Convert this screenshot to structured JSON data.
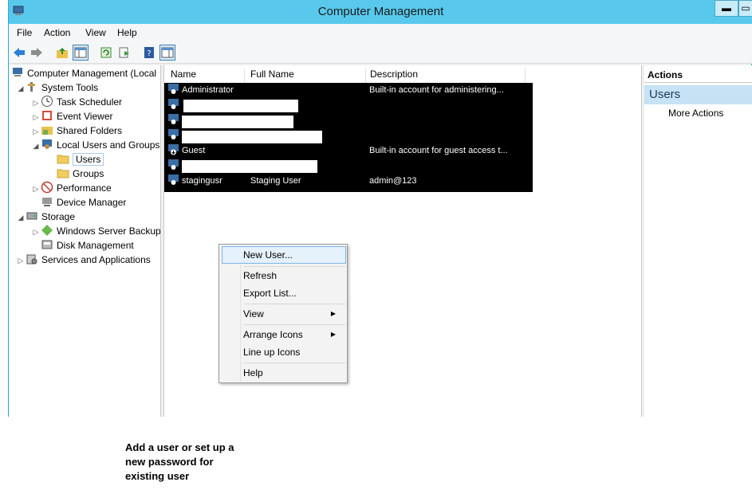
{
  "window": {
    "title": "Computer Management",
    "minimize_label": "▬",
    "maximize_label": "▭"
  },
  "menu": [
    "File",
    "Action",
    "View",
    "Help"
  ],
  "tree": {
    "root": "Computer Management (Local",
    "system_tools": "System Tools",
    "task_scheduler": "Task Scheduler",
    "event_viewer": "Event Viewer",
    "shared_folders": "Shared Folders",
    "local_users_groups": "Local Users and Groups",
    "users": "Users",
    "groups": "Groups",
    "performance": "Performance",
    "device_manager": "Device Manager",
    "storage": "Storage",
    "windows_server_backup": "Windows Server Backup",
    "disk_management": "Disk Management",
    "services_apps": "Services and Applications"
  },
  "list": {
    "columns": [
      "Name",
      "Full Name",
      "Description"
    ],
    "rows": [
      {
        "name": "Administrator",
        "full_name": "",
        "description": "Built-in account for administering..."
      },
      {
        "name": "",
        "full_name": "",
        "description": ""
      },
      {
        "name": "",
        "full_name": "",
        "description": ""
      },
      {
        "name": "",
        "full_name": "",
        "description": ""
      },
      {
        "name": "Guest",
        "full_name": "",
        "description": "Built-in account for guest access t..."
      },
      {
        "name": "",
        "full_name": "",
        "description": ""
      },
      {
        "name": "stagingusr",
        "full_name": "Staging User",
        "description": "admin@123"
      }
    ]
  },
  "context_menu": {
    "new_user": "New User...",
    "refresh": "Refresh",
    "export_list": "Export List...",
    "view": "View",
    "arrange_icons": "Arrange Icons",
    "line_up_icons": "Line up Icons",
    "help": "Help"
  },
  "actions": {
    "header": "Actions",
    "section": "Users",
    "more": "More Actions"
  },
  "caption": "Add a user or set up a new password for existing user",
  "colors": {
    "titlebar": "#58c9ec",
    "highlight": "#c6e2f4",
    "menu_hover": "#e5f1fb"
  }
}
